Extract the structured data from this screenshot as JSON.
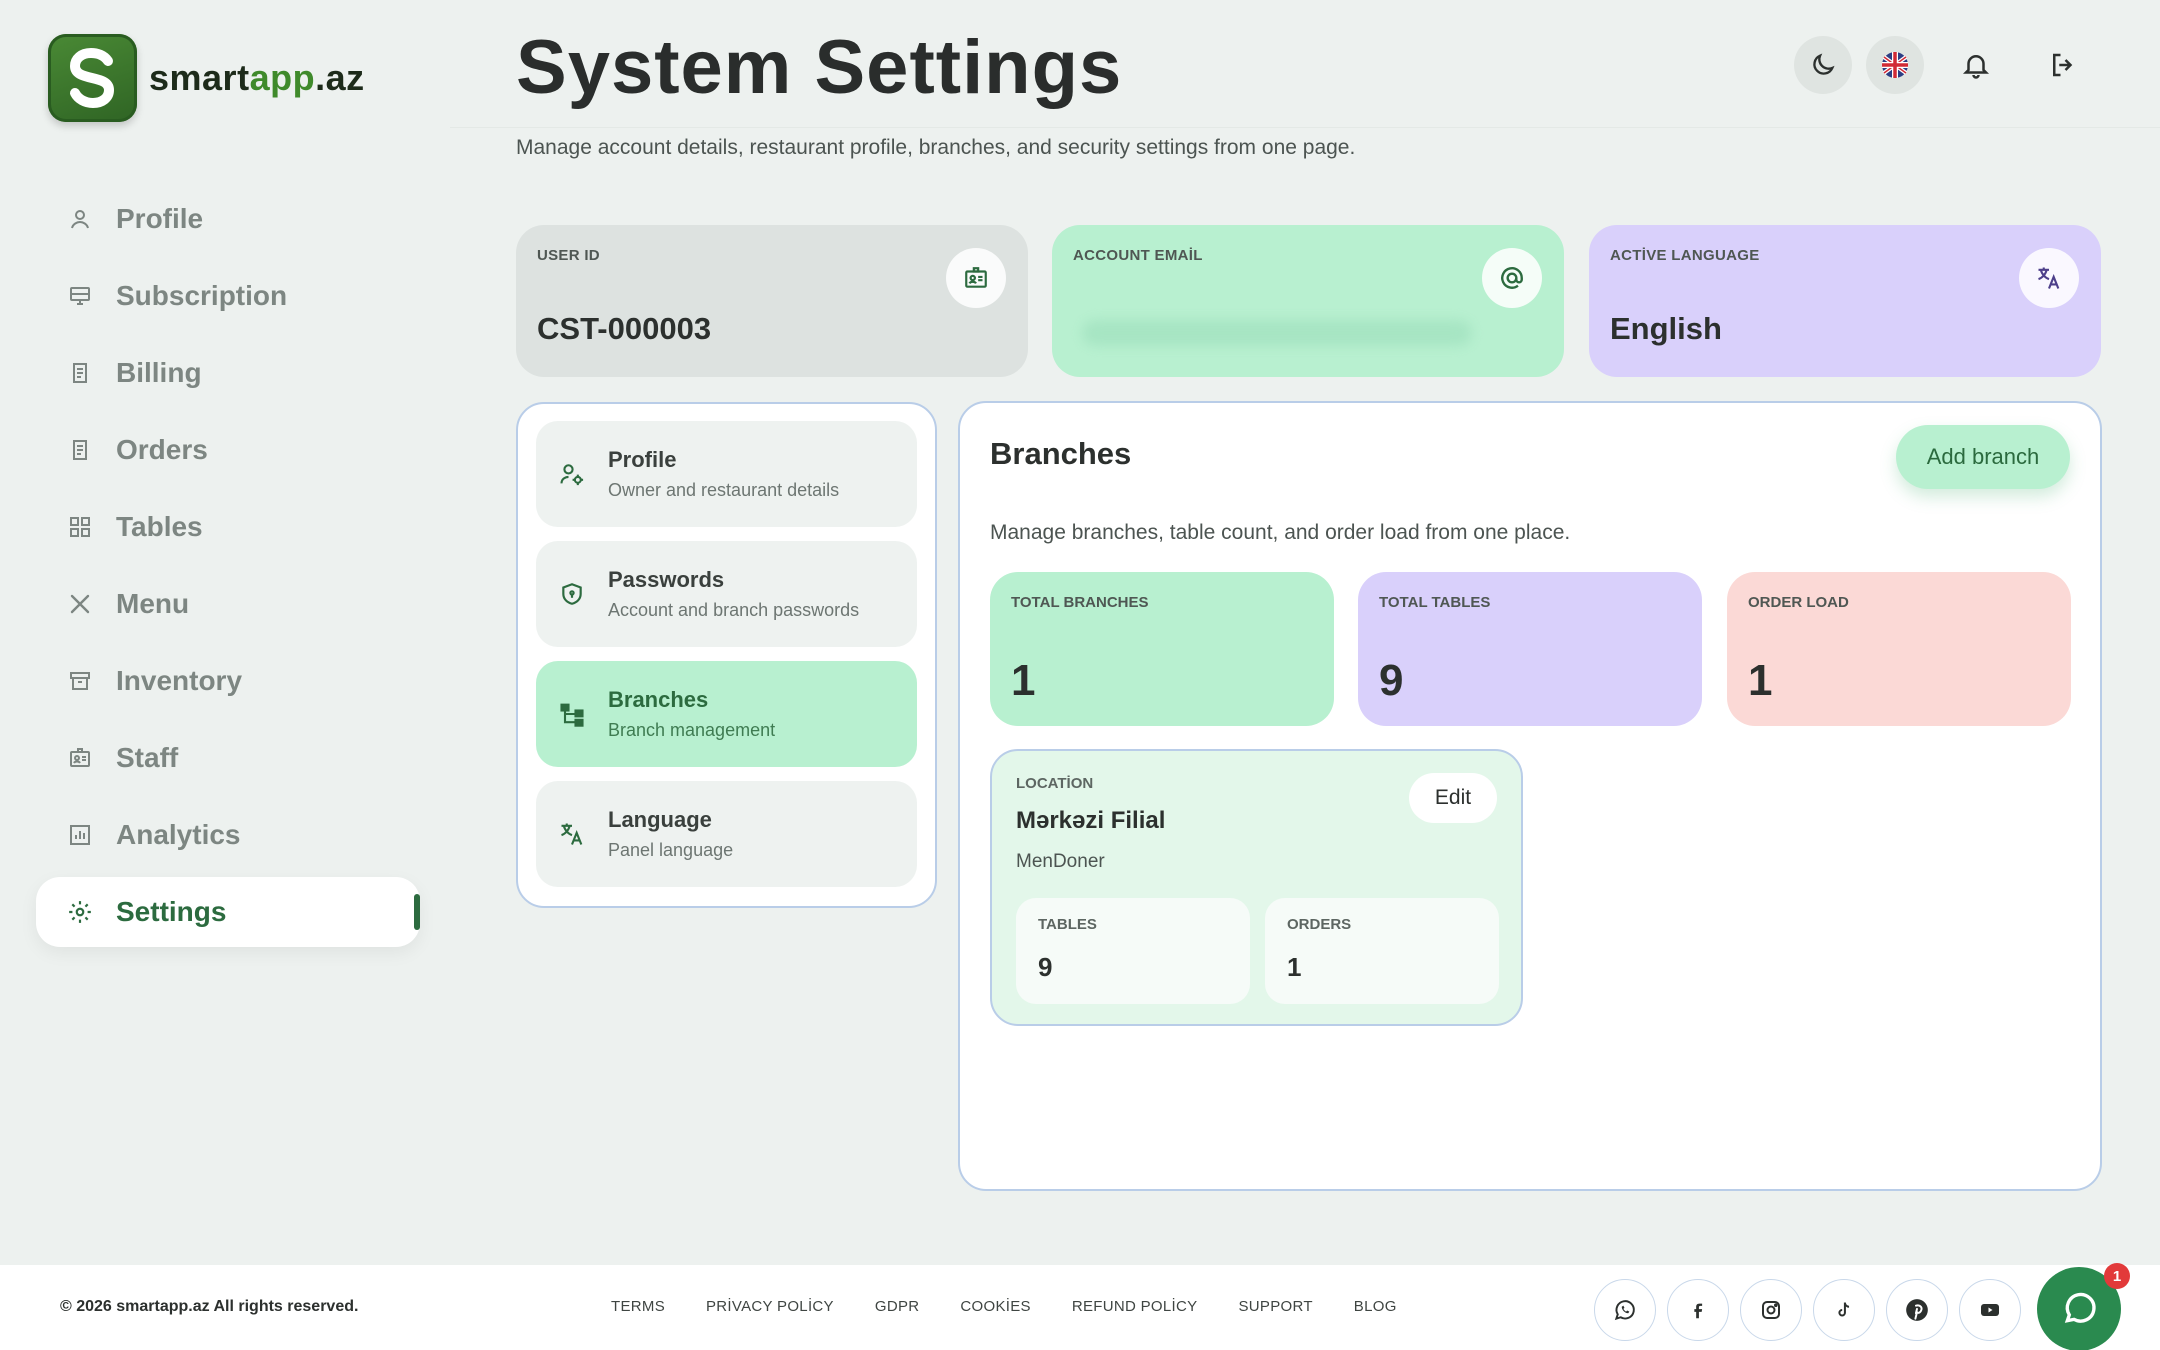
{
  "brand": {
    "name_part1": "smart",
    "name_part2": "app",
    "name_part3": ".az",
    "logo_letter": "S"
  },
  "sidebar": {
    "items": [
      {
        "label": "Profile",
        "icon": "user-icon"
      },
      {
        "label": "Subscription",
        "icon": "monitor-icon"
      },
      {
        "label": "Billing",
        "icon": "receipt-icon"
      },
      {
        "label": "Orders",
        "icon": "receipt-icon"
      },
      {
        "label": "Tables",
        "icon": "grid-icon"
      },
      {
        "label": "Menu",
        "icon": "utensils-icon"
      },
      {
        "label": "Inventory",
        "icon": "archive-icon"
      },
      {
        "label": "Staff",
        "icon": "id-card-icon"
      },
      {
        "label": "Analytics",
        "icon": "bar-chart-icon"
      },
      {
        "label": "Settings",
        "icon": "gear-icon",
        "active": true
      }
    ]
  },
  "header": {
    "title": "System Settings",
    "description": "Manage account details, restaurant profile, branches, and security settings from one page.",
    "buttons": [
      "moon-icon",
      "uk-flag-icon",
      "bell-icon",
      "logout-icon"
    ]
  },
  "stats": {
    "user_id": {
      "label": "USER ID",
      "value": "CST-000003",
      "icon": "id-card-icon"
    },
    "account_email": {
      "label": "ACCOUNT EMAİL",
      "value": "",
      "icon": "at-icon"
    },
    "active_language": {
      "label": "ACTİVE LANGUAGE",
      "value": "English",
      "icon": "translate-icon"
    }
  },
  "settings_menu": [
    {
      "title": "Profile",
      "subtitle": "Owner and restaurant details",
      "icon": "user-gear-icon"
    },
    {
      "title": "Passwords",
      "subtitle": "Account and branch passwords",
      "icon": "shield-icon"
    },
    {
      "title": "Branches",
      "subtitle": "Branch management",
      "icon": "hierarchy-icon",
      "active": true
    },
    {
      "title": "Language",
      "subtitle": "Panel language",
      "icon": "translate-icon"
    }
  ],
  "branches": {
    "title": "Branches",
    "add_label": "Add branch",
    "description": "Manage branches, table count, and order load from one place.",
    "totals": [
      {
        "label": "TOTAL BRANCHES",
        "value": "1"
      },
      {
        "label": "TOTAL TABLES",
        "value": "9"
      },
      {
        "label": "ORDER LOAD",
        "value": "1"
      }
    ],
    "location": {
      "label": "LOCATİON",
      "name": "Mərkəzi Filial",
      "restaurant": "MenDoner",
      "edit_label": "Edit",
      "tables_label": "TABLES",
      "tables_value": "9",
      "orders_label": "ORDERS",
      "orders_value": "1"
    }
  },
  "footer": {
    "copyright": "© 2026 smartapp.az All rights reserved.",
    "links": [
      "TERMS",
      "PRİVACY POLİCY",
      "GDPR",
      "COOKİES",
      "REFUND POLİCY",
      "SUPPORT",
      "BLOG"
    ],
    "socials": [
      "whatsapp-icon",
      "facebook-icon",
      "instagram-icon",
      "tiktok-icon",
      "pinterest-icon",
      "youtube-icon"
    ]
  },
  "chat": {
    "badge": "1"
  },
  "colors": {
    "accent": "#2c6b3f",
    "mint": "#b8f0d0",
    "lavender": "#d9d0fb",
    "pink": "#fbd9d6",
    "gray": "#dde2e0"
  }
}
